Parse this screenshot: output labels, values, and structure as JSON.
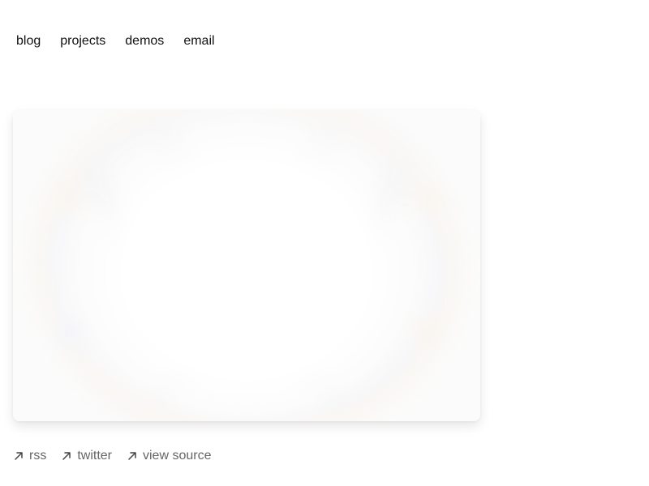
{
  "nav": {
    "items": [
      {
        "label": "blog"
      },
      {
        "label": "projects"
      },
      {
        "label": "demos"
      },
      {
        "label": "email"
      }
    ]
  },
  "footer": {
    "links": [
      {
        "label": "rss",
        "icon": "arrow-up-right-icon"
      },
      {
        "label": "twitter",
        "icon": "arrow-up-right-icon"
      },
      {
        "label": "view source",
        "icon": "arrow-up-right-icon"
      }
    ]
  },
  "colors": {
    "text": "#111111",
    "muted": "#666666",
    "background": "#ffffff"
  }
}
